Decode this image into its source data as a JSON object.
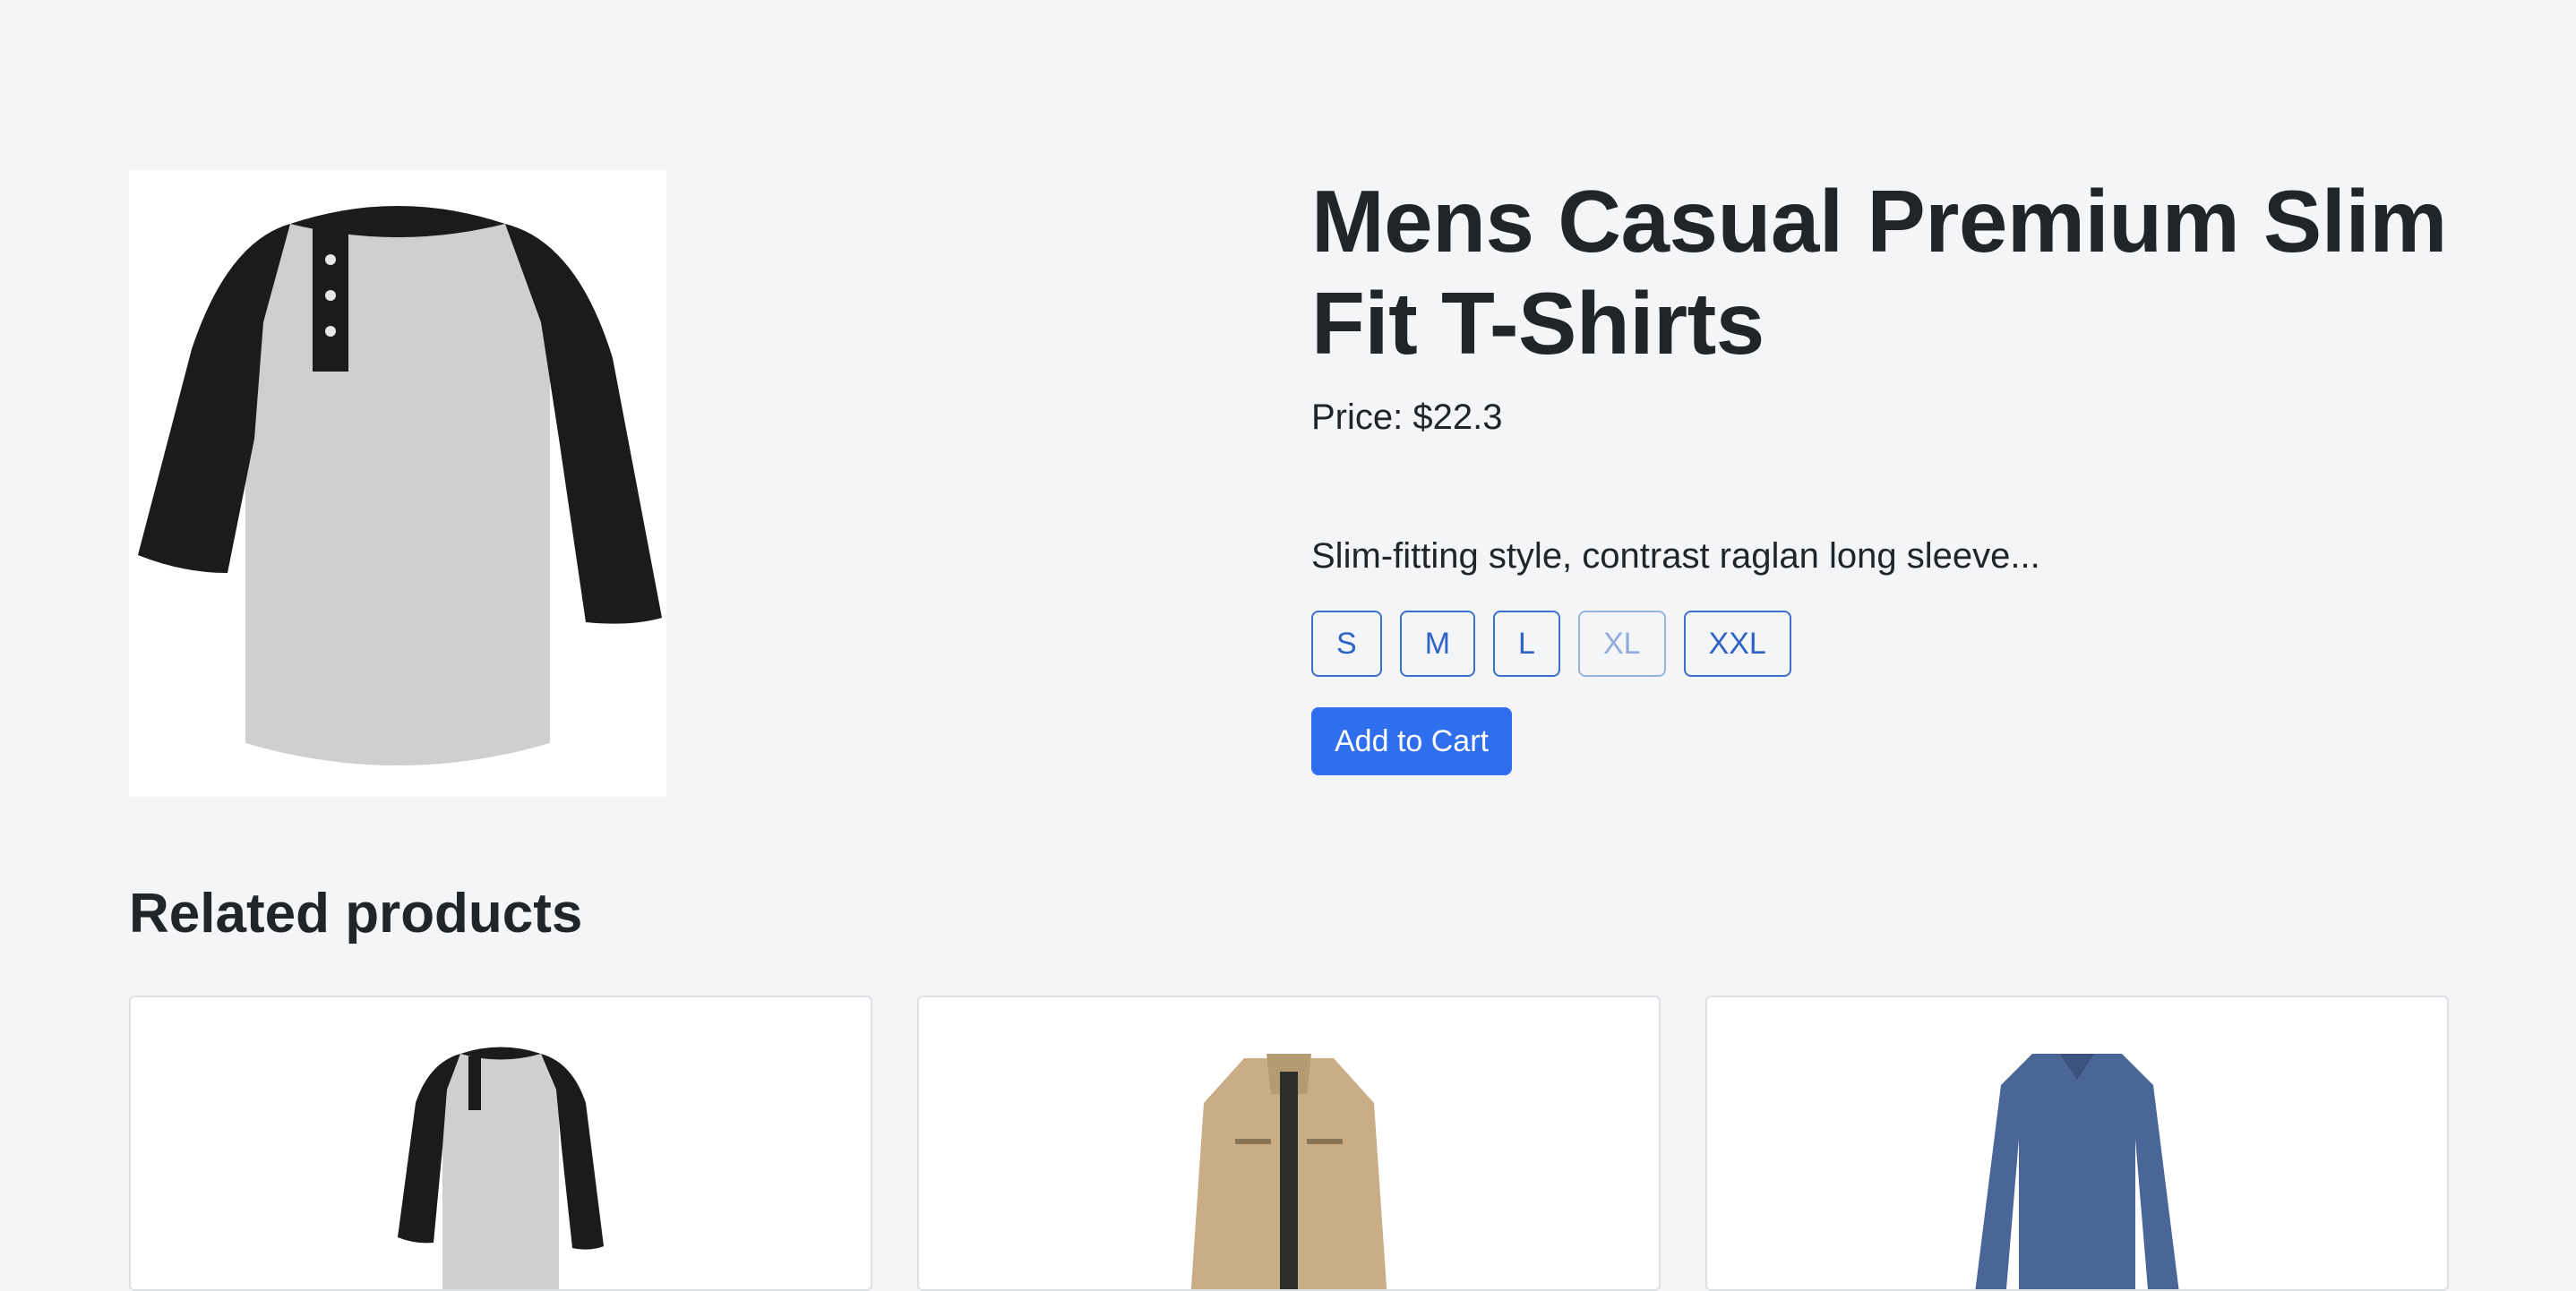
{
  "product": {
    "title": "Mens Casual Premium Slim Fit T-Shirts",
    "price": "Price: $22.3",
    "description": "Slim-fitting style, contrast raglan long sleeve...",
    "image_icon": "raglan-henley-shirt-image",
    "sizes": [
      {
        "label": "S",
        "disabled": false
      },
      {
        "label": "M",
        "disabled": false
      },
      {
        "label": "L",
        "disabled": false
      },
      {
        "label": "XL",
        "disabled": true
      },
      {
        "label": "XXL",
        "disabled": false
      }
    ],
    "add_to_cart_label": "Add to Cart"
  },
  "related": {
    "title": "Related products",
    "items": [
      {
        "image": "raglan-henley-shirt-image"
      },
      {
        "image": "khaki-jacket-image"
      },
      {
        "image": "blue-vneck-sweater-image"
      }
    ]
  },
  "colors": {
    "accent": "#2f6fee",
    "size_border": "#3b71ca",
    "background": "#f4f5f7",
    "text": "#212529"
  }
}
